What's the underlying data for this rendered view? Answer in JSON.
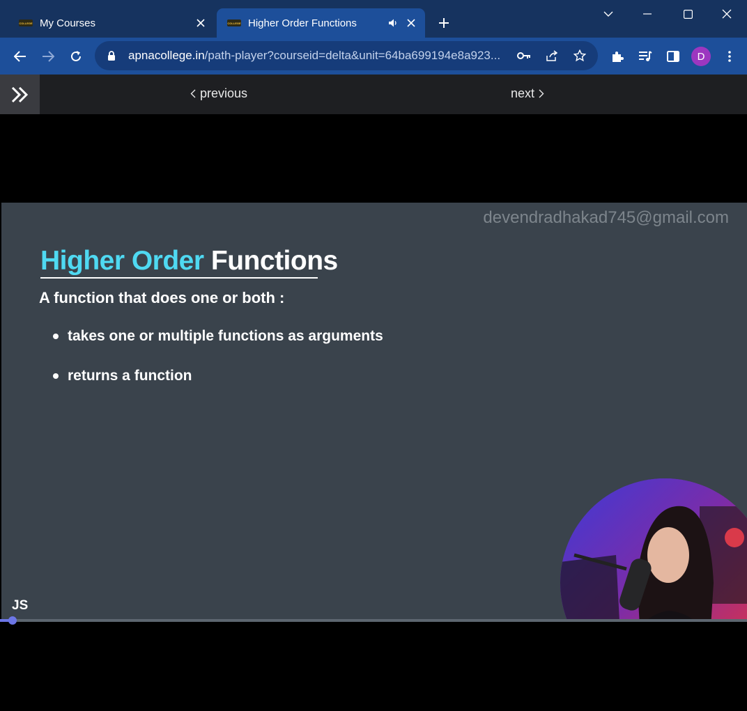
{
  "browser": {
    "tabs": [
      {
        "title": "My Courses",
        "favicon_text": "COLLEGE"
      },
      {
        "title": "Higher Order Functions",
        "favicon_text": "COLLEGE"
      }
    ],
    "url": {
      "host": "apnacollege.in",
      "path": "/path-player?courseid=delta&unit=64ba699194e8a923..."
    },
    "profile_initial": "D",
    "accent_colors": {
      "frame": "#16335f",
      "toolbar": "#1d4f9a",
      "avatar": "#9c37c0"
    }
  },
  "course_nav": {
    "previous_label": "previous",
    "next_label": "next"
  },
  "slide": {
    "watermark": "devendradhakad745@gmail.com",
    "title_highlight": "Higher Order",
    "title_rest": "Functions",
    "subtitle": "A function that does one or both :",
    "bullets": [
      "takes one or multiple functions as arguments",
      "returns a function"
    ],
    "corner_tag": "JS",
    "colors": {
      "background": "#3a434c",
      "title_highlight": "#4fd9f2"
    }
  },
  "player": {
    "progress_fraction": 0.015,
    "progress_color": "#6c76e6"
  },
  "icons": [
    "close-icon",
    "speaker-icon",
    "plus-icon",
    "chevron-down-icon",
    "minimize-icon",
    "maximize-icon",
    "window-close-icon",
    "back-arrow-icon",
    "forward-arrow-icon",
    "reload-icon",
    "lock-icon",
    "key-icon",
    "share-icon",
    "star-icon",
    "extensions-icon",
    "media-icon",
    "sidepanel-icon",
    "more-icon",
    "double-chevron-right-icon",
    "chevron-left-icon",
    "chevron-right-icon"
  ]
}
